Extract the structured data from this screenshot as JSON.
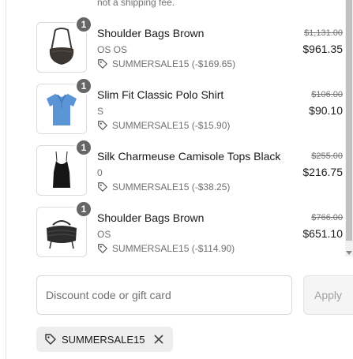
{
  "top_note": "not a shipping fee.",
  "items": [
    {
      "quantity": "1",
      "name": "Shoulder Bags Brown",
      "variant": "OS OS",
      "discount": "SUMMERSALE15 (-$169.65)",
      "original_price": "$1,131.00",
      "price": "$961.35"
    },
    {
      "quantity": "1",
      "name": "Slim Fit Classic Polo Shirt",
      "variant": "S",
      "discount": "SUMMERSALE15 (-$15.90)",
      "original_price": "$106.00",
      "price": "$90.10"
    },
    {
      "quantity": "1",
      "name": "Silk Charmeuse Camisole Tops Black",
      "variant": "0",
      "discount": "SUMMERSALE15 (-$38.25)",
      "original_price": "$255.00",
      "price": "$216.75"
    },
    {
      "quantity": "1",
      "name": "Shoulder Bags Brown",
      "variant": "OS",
      "discount": "SUMMERSALE15 (-$114.90)",
      "original_price": "$766.00",
      "price": "$651.10"
    }
  ],
  "discount_form": {
    "placeholder": "Discount code or gift card",
    "apply_label": "Apply"
  },
  "applied_code": {
    "label": "SUMMERSALE15"
  },
  "colors": {
    "badge": "#666666",
    "muted_text": "#707070",
    "chip_bg": "#ededed"
  }
}
